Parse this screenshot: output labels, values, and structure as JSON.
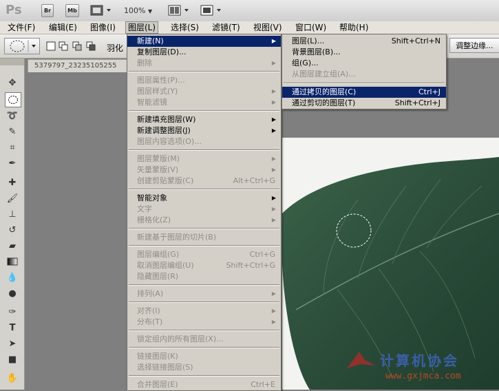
{
  "app": {
    "logo": "Ps",
    "bridge_label": "Br",
    "mini_bridge_label": "Mb",
    "zoom": "100%"
  },
  "menubar": [
    "文件(F)",
    "编辑(E)",
    "图像(I)",
    "图层(L)",
    "选择(S)",
    "滤镜(T)",
    "视图(V)",
    "窗口(W)",
    "帮助(H)"
  ],
  "options": {
    "feather_label": "羽化",
    "refine_edge_label": "调整边缘..."
  },
  "document": {
    "tab_title": "5379797_23235105255"
  },
  "layer_menu": {
    "items": [
      {
        "label": "新建(N)",
        "submenu": true,
        "highlight": true
      },
      {
        "label": "复制图层(D)..."
      },
      {
        "label": "删除",
        "submenu": true,
        "disabled": true
      },
      {
        "sep": true
      },
      {
        "label": "图层属性(P)...",
        "disabled": true
      },
      {
        "label": "图层样式(Y)",
        "submenu": true,
        "disabled": true
      },
      {
        "label": "智能滤镜",
        "submenu": true,
        "disabled": true
      },
      {
        "sep": true
      },
      {
        "label": "新建填充图层(W)",
        "submenu": true
      },
      {
        "label": "新建调整图层(J)",
        "submenu": true
      },
      {
        "label": "图层内容选项(O)...",
        "disabled": true
      },
      {
        "sep": true
      },
      {
        "label": "图层蒙版(M)",
        "submenu": true,
        "disabled": true
      },
      {
        "label": "矢量蒙版(V)",
        "submenu": true,
        "disabled": true
      },
      {
        "label": "创建剪贴蒙版(C)",
        "shortcut": "Alt+Ctrl+G",
        "disabled": true
      },
      {
        "sep": true
      },
      {
        "label": "智能对象",
        "submenu": true
      },
      {
        "label": "文字",
        "submenu": true,
        "disabled": true
      },
      {
        "label": "栅格化(Z)",
        "submenu": true,
        "disabled": true
      },
      {
        "sep": true
      },
      {
        "label": "新建基于图层的切片(B)",
        "disabled": true
      },
      {
        "sep": true
      },
      {
        "label": "图层编组(G)",
        "shortcut": "Ctrl+G",
        "disabled": true
      },
      {
        "label": "取消图层编组(U)",
        "shortcut": "Shift+Ctrl+G",
        "disabled": true
      },
      {
        "label": "隐藏图层(R)",
        "disabled": true
      },
      {
        "sep": true
      },
      {
        "label": "排列(A)",
        "submenu": true,
        "disabled": true
      },
      {
        "sep": true
      },
      {
        "label": "对齐(I)",
        "submenu": true,
        "disabled": true
      },
      {
        "label": "分布(T)",
        "submenu": true,
        "disabled": true
      },
      {
        "sep": true
      },
      {
        "label": "锁定组内的所有图层(X)...",
        "disabled": true
      },
      {
        "sep": true
      },
      {
        "label": "链接图层(K)",
        "disabled": true
      },
      {
        "label": "选择链接图层(S)",
        "disabled": true
      },
      {
        "sep": true
      },
      {
        "label": "合并图层(E)",
        "shortcut": "Ctrl+E",
        "disabled": true
      }
    ]
  },
  "new_submenu": {
    "items": [
      {
        "label": "图层(L)...",
        "shortcut": "Shift+Ctrl+N"
      },
      {
        "label": "背景图层(B)..."
      },
      {
        "label": "组(G)..."
      },
      {
        "label": "从图层建立组(A)...",
        "disabled": true
      },
      {
        "sep": true
      },
      {
        "label": "通过拷贝的图层(C)",
        "shortcut": "Ctrl+J",
        "highlight": true
      },
      {
        "label": "通过剪切的图层(T)",
        "shortcut": "Shift+Ctrl+J"
      }
    ]
  },
  "watermark": {
    "title": "计算机协会",
    "url": "www.gxjmca.com"
  },
  "colors": {
    "highlight": "#0a246a",
    "menu_bg": "#d4d0c8",
    "leaf": "#2d4f3c"
  }
}
